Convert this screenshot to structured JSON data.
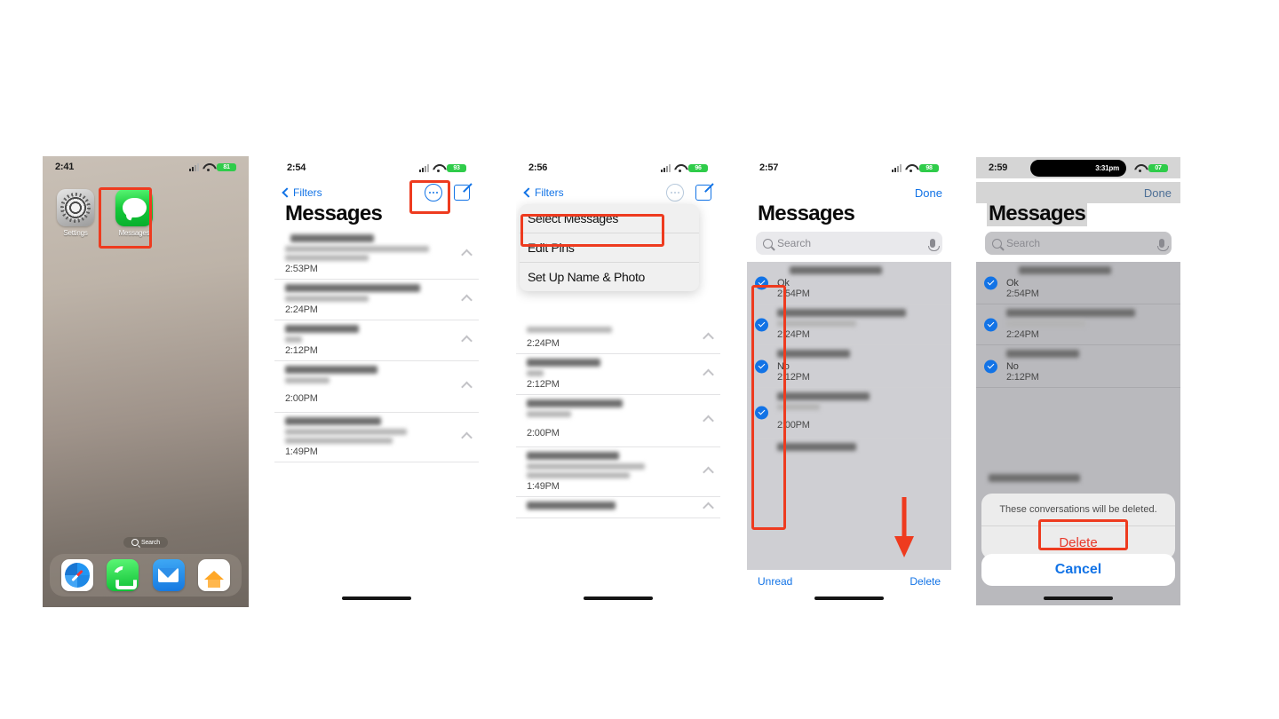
{
  "panels": [
    {
      "id": "home-screen",
      "status": {
        "time": "2:41",
        "battery": "81",
        "wifi_icon": "wifi-icon",
        "cellular_icon": "cellular-bars-icon"
      },
      "apps": [
        {
          "label": "Settings",
          "icon": "settings-gear-icon"
        },
        {
          "label": "Messages",
          "icon": "messages-bubble-icon"
        }
      ],
      "search_pill": {
        "label": "Search",
        "icon": "search-icon"
      },
      "dock": [
        {
          "label": "Safari",
          "icon": "safari-compass-icon"
        },
        {
          "label": "Phone",
          "icon": "phone-handset-icon"
        },
        {
          "label": "Mail",
          "icon": "mail-envelope-icon"
        },
        {
          "label": "Home",
          "icon": "home-house-icon"
        }
      ]
    },
    {
      "id": "messages-list",
      "status": {
        "time": "2:54",
        "battery": "93"
      },
      "nav": {
        "back_label": "Filters",
        "more_icon": "more-circle-icon",
        "compose_icon": "compose-icon"
      },
      "title": "Messages",
      "conversations": [
        {
          "name": "",
          "lines": 2,
          "time": "2:53PM"
        },
        {
          "name": "",
          "lines": 1,
          "time": "2:24PM"
        },
        {
          "name": "",
          "lines": 1,
          "time": "2:12PM"
        },
        {
          "name": "",
          "lines": 1,
          "time": "2:00PM"
        },
        {
          "name": "",
          "lines": 2,
          "time": "1:49PM"
        }
      ]
    },
    {
      "id": "messages-more-menu",
      "status": {
        "time": "2:56",
        "battery": "96"
      },
      "nav": {
        "back_label": "Filters",
        "more_icon": "more-circle-icon",
        "compose_icon": "compose-icon"
      },
      "menu_items": [
        {
          "label": "Select Messages",
          "highlighted": true
        },
        {
          "label": "Edit Pins",
          "highlighted": false
        },
        {
          "label": "Set Up Name & Photo",
          "highlighted": false
        }
      ],
      "conversations": [
        {
          "time": "2:24PM"
        },
        {
          "time": "2:12PM"
        },
        {
          "time": "2:00PM"
        },
        {
          "time": "1:49PM"
        },
        {
          "time": ""
        }
      ]
    },
    {
      "id": "messages-selection",
      "status": {
        "time": "2:57",
        "battery": "98"
      },
      "nav": {
        "done_label": "Done"
      },
      "title": "Messages",
      "search": {
        "placeholder": "Search",
        "icon": "search-icon",
        "mic_icon": "microphone-icon"
      },
      "conversations": [
        {
          "snippet": "Ok",
          "time": "2:54PM",
          "selected": true
        },
        {
          "snippet": "",
          "time": "2:24PM",
          "selected": true
        },
        {
          "snippet": "No",
          "time": "2:12PM",
          "selected": true
        },
        {
          "snippet": "",
          "time": "2:00PM",
          "selected": true
        }
      ],
      "toolbar": {
        "unread_label": "Unread",
        "delete_label": "Delete"
      }
    },
    {
      "id": "messages-delete-confirm",
      "status": {
        "time": "2:59",
        "island_time": "3:31pm",
        "battery": "07"
      },
      "nav": {
        "done_label": "Done"
      },
      "title": "Messages",
      "search": {
        "placeholder": "Search",
        "icon": "search-icon",
        "mic_icon": "microphone-icon"
      },
      "conversations": [
        {
          "snippet": "Ok",
          "time": "2:54PM",
          "selected": true
        },
        {
          "snippet": "",
          "time": "2:24PM",
          "selected": true
        },
        {
          "snippet": "No",
          "time": "2:12PM",
          "selected": true
        }
      ],
      "sheet": {
        "message": "These conversations will be deleted.",
        "delete_label": "Delete",
        "cancel_label": "Cancel"
      }
    }
  ],
  "annotations": {
    "accent_color": "#ee3b1f"
  }
}
